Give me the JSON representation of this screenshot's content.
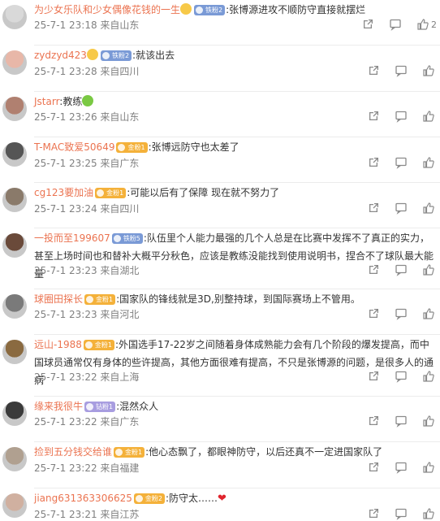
{
  "comments": [
    {
      "user": "为少女乐队和少女偶像花钱的一生",
      "badge": "铁粉2",
      "badge_type": "iron",
      "text": ":张博源进攻不顺防守直接就摆烂",
      "meta": "25-7-1 23:18 来自山东",
      "likes": "2",
      "has_emoji": true,
      "avatar_color": "#d9d9d9"
    },
    {
      "user": "zydzyd423",
      "badge": "铁粉2",
      "badge_type": "iron",
      "text": ":就该出去",
      "meta": "25-7-1 23:28 来自四川",
      "likes": "",
      "has_emoji": true,
      "avatar_color": "#e8b7a8"
    },
    {
      "user": "Jstarr",
      "badge": "",
      "badge_type": "",
      "text": ":教练",
      "meta": "25-7-1 23:26 来自山东",
      "likes": "",
      "has_emoji": false,
      "avatar_color": "#b08070",
      "text_suffix_emoji": true
    },
    {
      "user": "T-MAC致爱50649",
      "badge": "金粉1",
      "badge_type": "gold",
      "text": ":张博远防守也太差了",
      "meta": "25-7-1 23:25 来自广东",
      "likes": "",
      "has_emoji": false,
      "avatar_color": "#555555"
    },
    {
      "user": "cg123要加油",
      "badge": "金粉1",
      "badge_type": "gold",
      "text": ":可能以后有了保障 现在就不努力了",
      "meta": "25-7-1 23:24 来自四川",
      "likes": "",
      "has_emoji": false,
      "avatar_color": "#8a7a6a"
    },
    {
      "user": "一投而至199607",
      "badge": "铁粉5",
      "badge_type": "iron",
      "text": ":队伍里个人能力最强的几个人总是在比赛中发挥不了真正的实力，甚至上场时间也和替补大概平分秋色，应该是教练没能找到使用说明书，捏合不了球队最大能量",
      "meta": "25-7-1 23:23 来自湖北",
      "likes": "",
      "has_emoji": false,
      "avatar_color": "#6a4a3a"
    },
    {
      "user": "球圈田探长",
      "badge": "金粉1",
      "badge_type": "gold",
      "text": ":国家队的锋线就是3D,别整持球，到国际赛场上不管用。",
      "meta": "25-7-1 23:23 来自河北",
      "likes": "",
      "has_emoji": false,
      "avatar_color": "#7a7a7a"
    },
    {
      "user": "远山-1988",
      "badge": "金粉1",
      "badge_type": "gold",
      "text": ":外国选手17-22岁之间随着身体成熟能力会有几个阶段的爆发提高，而中国球员通常仅有身体的些许提高，其他方面很难有提高，不只是张博源的问题，是很多人的通病",
      "meta": "25-7-1 23:22 来自上海",
      "likes": "",
      "has_emoji": false,
      "avatar_color": "#8a6a40"
    },
    {
      "user": "缘来我很牛",
      "badge": "钻粉1",
      "badge_type": "silver",
      "text": ":混然众人",
      "meta": "25-7-1 23:22 来自广东",
      "likes": "",
      "has_emoji": false,
      "avatar_color": "#3a3a3a"
    },
    {
      "user": "捡到五分钱交给谁",
      "badge": "金粉1",
      "badge_type": "gold",
      "text": ":他心态飘了，都眼神防守，以后还真不一定进国家队了",
      "meta": "25-7-1 23:22 来自福建",
      "likes": "",
      "has_emoji": false,
      "avatar_color": "#b0a090"
    },
    {
      "user": "jiang631363306625",
      "badge": "金粉2",
      "badge_type": "gold",
      "text": ":防守太……",
      "meta": "25-7-1 23:21 来自江苏",
      "likes": "",
      "has_emoji": false,
      "avatar_color": "#d0b0a0",
      "text_suffix_heart": true
    }
  ],
  "icons": {
    "share": "share-icon",
    "comment": "comment-icon",
    "like": "like-icon"
  },
  "colors": {
    "username": "#eb7350",
    "meta": "#808080",
    "gold_badge": "#f4b13a",
    "iron_badge": "#7a9ad6"
  }
}
